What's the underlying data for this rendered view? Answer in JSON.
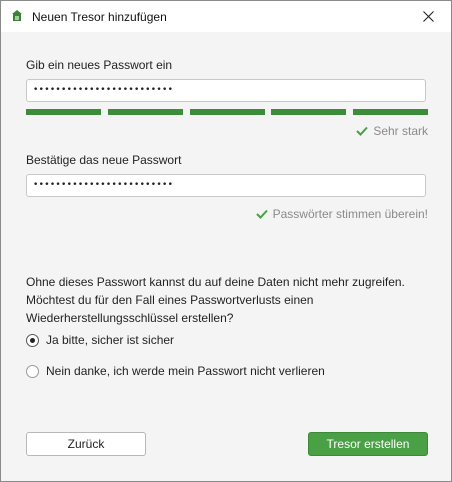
{
  "window": {
    "title": "Neuen Tresor hinzufügen",
    "icon": "cryptomator-icon"
  },
  "form": {
    "new_password_label": "Gib ein neues Passwort ein",
    "new_password_value": "•••••••••••••••••••••••••",
    "strength": {
      "segments_filled": 5,
      "segments_total": 5,
      "color": "#3c8c3a",
      "label": "Sehr stark"
    },
    "confirm_password_label": "Bestätige das neue Passwort",
    "confirm_password_value": "•••••••••••••••••••••••••",
    "match_label": "Passwörter stimmen überein!"
  },
  "recovery": {
    "info_line1": "Ohne dieses Passwort kannst du auf deine Daten nicht mehr zugreifen.",
    "info_line2": "Möchtest du für den Fall eines Passwortverlusts einen",
    "info_line3": "Wiederherstellungsschlüssel erstellen?",
    "options": [
      {
        "label": "Ja bitte, sicher ist sicher",
        "selected": true
      },
      {
        "label": "Nein danke, ich werde mein Passwort nicht verlieren",
        "selected": false
      }
    ]
  },
  "buttons": {
    "back_label": "Zurück",
    "create_label": "Tresor erstellen"
  },
  "colors": {
    "accent": "#49a045",
    "background": "#f4f4f4"
  }
}
